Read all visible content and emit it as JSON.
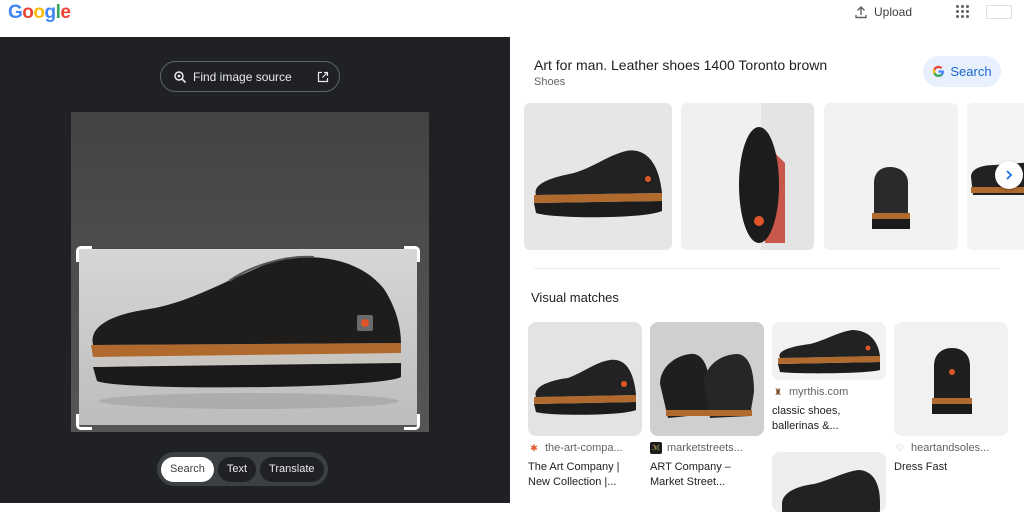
{
  "header": {
    "logo": [
      "G",
      "o",
      "o",
      "g",
      "l",
      "e"
    ],
    "logo_colors": [
      "#4285F4",
      "#EA4335",
      "#FBBC05",
      "#4285F4",
      "#34A853",
      "#EA4335"
    ],
    "upload_label": "Upload"
  },
  "left": {
    "find_source_label": "Find image source",
    "modes": [
      "Search",
      "Text",
      "Translate"
    ],
    "active_mode": "Search"
  },
  "right": {
    "title": "Art for man. Leather shoes 1400 Toronto brown",
    "subtitle": "Shoes",
    "search_label": "Search",
    "visual_matches_title": "Visual matches",
    "matches": [
      {
        "source": "the-art-compa...",
        "title": "The Art Company | New Collection |...",
        "favicon": "art-company-star"
      },
      {
        "source": "marketstreets...",
        "title": "ART Company – Market Street...",
        "favicon": "market-street-logo"
      },
      {
        "source": "myrthis.com",
        "title": "classic shoes, ballerinas &...",
        "favicon": "boot-icon"
      },
      {
        "source": "heartandsoles...",
        "title": "Dress Fast",
        "favicon": "heart-soles-logo"
      }
    ]
  },
  "colors": {
    "accent_blue": "#1a73e8",
    "dark_pane": "#202124",
    "search_pill_bg": "#e8f0fe"
  }
}
